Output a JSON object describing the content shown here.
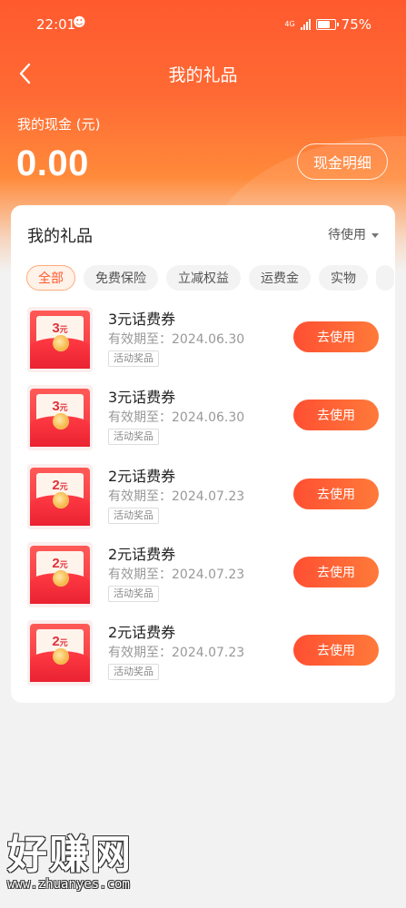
{
  "status_bar": {
    "time": "22:01",
    "battery": "75%",
    "network": "4G"
  },
  "header": {
    "title": "我的礼品"
  },
  "cash": {
    "label": "我的现金 (元)",
    "value": "0.00",
    "detail_button": "现金明细"
  },
  "card": {
    "title": "我的礼品",
    "filter": "待使用",
    "tabs": [
      "全部",
      "免费保险",
      "立减权益",
      "运费金",
      "实物"
    ],
    "gifts": [
      {
        "amount": "3",
        "unit": "元",
        "name": "3元话费券",
        "valid": "有效期至：2024.06.30",
        "tag": "活动奖品",
        "action": "去使用"
      },
      {
        "amount": "3",
        "unit": "元",
        "name": "3元话费券",
        "valid": "有效期至：2024.06.30",
        "tag": "活动奖品",
        "action": "去使用"
      },
      {
        "amount": "2",
        "unit": "元",
        "name": "2元话费券",
        "valid": "有效期至：2024.07.23",
        "tag": "活动奖品",
        "action": "去使用"
      },
      {
        "amount": "2",
        "unit": "元",
        "name": "2元话费券",
        "valid": "有效期至：2024.07.23",
        "tag": "活动奖品",
        "action": "去使用"
      },
      {
        "amount": "2",
        "unit": "元",
        "name": "2元话费券",
        "valid": "有效期至：2024.07.23",
        "tag": "活动奖品",
        "action": "去使用"
      }
    ]
  },
  "watermark": {
    "title": "好赚网",
    "url": "www.zhuanyes.com"
  },
  "colors": {
    "accent": "#ff5a2e",
    "button": "#ff6a36",
    "envelope": "#f22e3a"
  }
}
